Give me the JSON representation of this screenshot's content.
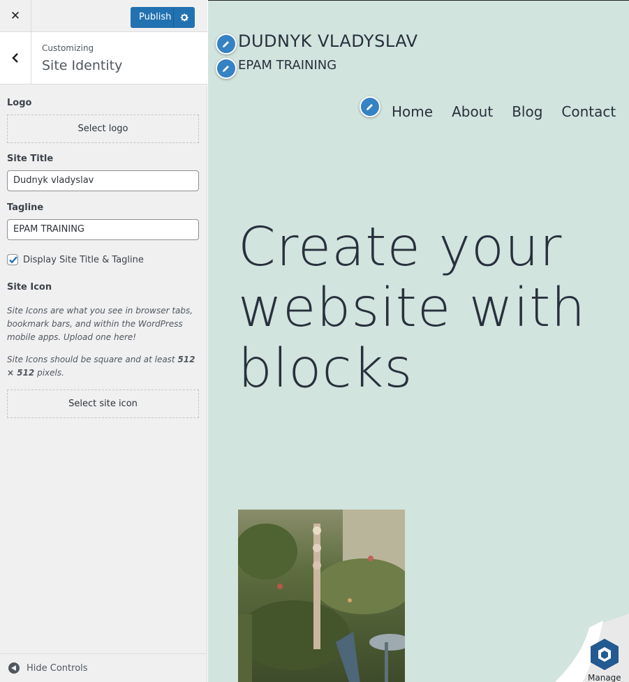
{
  "customizer": {
    "close_label": "Close",
    "publish_label": "Publish",
    "breadcrumb": "Customizing",
    "section_title": "Site Identity",
    "logo": {
      "label": "Logo",
      "button": "Select logo"
    },
    "site_title": {
      "label": "Site Title",
      "value": "Dudnyk vladyslav"
    },
    "tagline": {
      "label": "Tagline",
      "value": "EPAM TRAINING"
    },
    "display_title_tagline": {
      "label": "Display Site Title & Tagline",
      "checked": true
    },
    "site_icon": {
      "label": "Site Icon",
      "desc_1": "Site Icons are what you see in browser tabs, bookmark bars, and within the WordPress mobile apps. Upload one here!",
      "desc_2_prefix": "Site Icons should be square and at least ",
      "desc_2_size": "512 × 512",
      "desc_2_suffix": " pixels.",
      "button": "Select site icon"
    },
    "hide_controls": "Hide Controls"
  },
  "preview": {
    "site_title": "DUDNYK VLADYSLAV",
    "tagline": "EPAM TRAINING",
    "nav": [
      "Home",
      "About",
      "Blog",
      "Contact"
    ],
    "hero": "Create your website with blocks",
    "manage_label": "Manage",
    "background": "#d1e4dd"
  },
  "colors": {
    "accent": "#2271b1",
    "pin": "#3582c4",
    "text": "#28303d"
  }
}
